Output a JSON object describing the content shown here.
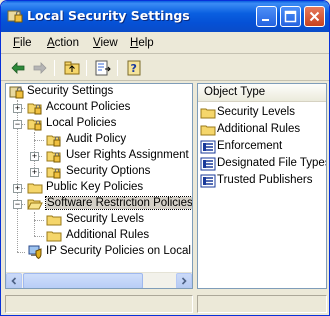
{
  "window": {
    "title": "Local Security Settings"
  },
  "menu": [
    {
      "label": "File",
      "accel": "F",
      "rest": "ile"
    },
    {
      "label": "Action",
      "accel": "A",
      "rest": "ction"
    },
    {
      "label": "View",
      "accel": "V",
      "rest": "iew"
    },
    {
      "label": "Help",
      "accel": "H",
      "rest": "elp"
    }
  ],
  "toolbar": {
    "icons": [
      "back-arrow-icon",
      "forward-arrow-icon",
      "up-folder-icon",
      "export-list-icon",
      "help-icon"
    ]
  },
  "tree": {
    "root": "Security Settings",
    "items": [
      {
        "label": "Account Policies",
        "icon": "folder-lock-icon"
      },
      {
        "label": "Local Policies",
        "icon": "folder-lock-icon"
      },
      {
        "label": "Audit Policy",
        "icon": "folder-lock-icon"
      },
      {
        "label": "User Rights Assignment",
        "icon": "folder-lock-icon"
      },
      {
        "label": "Security Options",
        "icon": "folder-lock-icon"
      },
      {
        "label": "Public Key Policies",
        "icon": "folder-icon"
      },
      {
        "label": "Software Restriction Policies",
        "icon": "folder-open-icon"
      },
      {
        "label": "Security Levels",
        "icon": "folder-icon"
      },
      {
        "label": "Additional Rules",
        "icon": "folder-icon"
      },
      {
        "label": "IP Security Policies on Local Co",
        "icon": "ip-security-icon"
      }
    ]
  },
  "list": {
    "column_header": "Object Type",
    "items": [
      {
        "label": "Security Levels",
        "icon": "folder-icon"
      },
      {
        "label": "Additional Rules",
        "icon": "folder-icon"
      },
      {
        "label": "Enforcement",
        "icon": "settings-doc-icon"
      },
      {
        "label": "Designated File Types",
        "icon": "settings-doc-icon"
      },
      {
        "label": "Trusted Publishers",
        "icon": "settings-doc-icon"
      }
    ]
  },
  "colors": {
    "titlebar": "#0a5fe0",
    "window_bg": "#ece9d8",
    "folder": "#f5d66b",
    "selection": "#d4d0c8"
  }
}
